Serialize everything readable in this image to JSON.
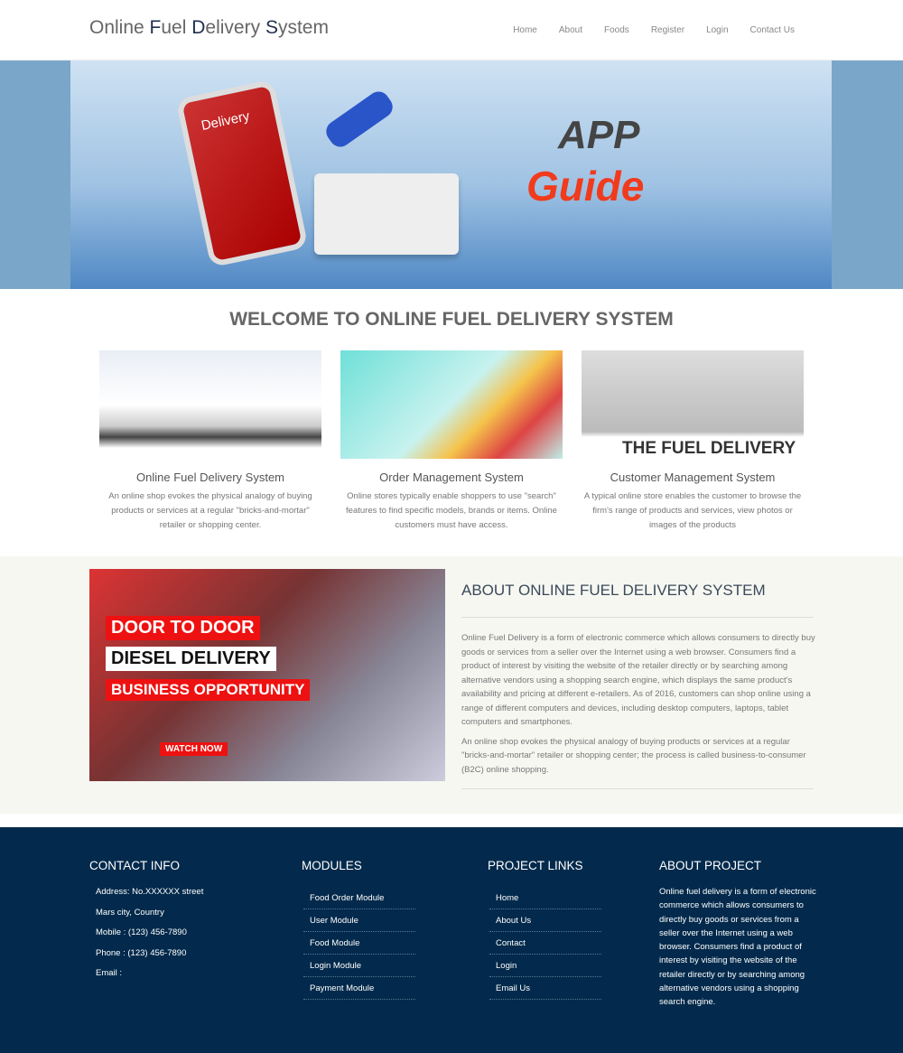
{
  "header": {
    "logo": [
      {
        "t": "Online ",
        "c": false
      },
      {
        "t": "F",
        "c": true
      },
      {
        "t": "uel ",
        "c": false
      },
      {
        "t": "D",
        "c": true
      },
      {
        "t": "elivery ",
        "c": false
      },
      {
        "t": "S",
        "c": true
      },
      {
        "t": "ystem",
        "c": false
      }
    ],
    "nav": [
      "Home",
      "About",
      "Foods",
      "Register",
      "Login",
      "Contact Us"
    ]
  },
  "banner": {
    "phone_text": "Delivery",
    "app": "APP",
    "guide": "Guide"
  },
  "welcome": "WELCOME TO ONLINE FUEL DELIVERY SYSTEM",
  "cards": [
    {
      "title": "Online Fuel Delivery System",
      "text": "An online shop evokes the physical analogy of buying products or services at a regular \"bricks-and-mortar\" retailer or shopping center."
    },
    {
      "title": "Order Management System",
      "text": "Online stores typically enable shoppers to use \"search\" features to find specific models, brands or items. Online customers must have access."
    },
    {
      "title": "Customer Management System",
      "text": "A typical online store enables the customer to browse the firm's range of products and services, view photos or images of the products",
      "img_caption": "THE FUEL DELIVERY"
    }
  ],
  "about": {
    "image_text": [
      "DOOR TO DOOR",
      "DIESEL DELIVERY",
      "BUSINESS OPPORTUNITY",
      "WATCH NOW"
    ],
    "title": "ABOUT ONLINE FUEL DELIVERY SYSTEM",
    "p1": "Online Fuel Delivery is a form of electronic commerce which allows consumers to directly buy goods or services from a seller over the Internet using a web browser. Consumers find a product of interest by visiting the website of the retailer directly or by searching among alternative vendors using a shopping search engine, which displays the same product's availability and pricing at different e-retailers. As of 2016, customers can shop online using a range of different computers and devices, including desktop computers, laptops, tablet computers and smartphones.",
    "p2": "An online shop evokes the physical analogy of buying products or services at a regular \"bricks-and-mortar\" retailer or shopping center; the process is called business-to-consumer (B2C) online shopping."
  },
  "footer": {
    "contact": {
      "title": "CONTACT INFO",
      "lines": [
        "Address: No.XXXXXX street",
        "Mars city, Country",
        "Mobile : (123) 456-7890",
        "Phone : (123) 456-7890",
        "Email :"
      ]
    },
    "modules": {
      "title": "MODULES",
      "items": [
        "Food Order Module",
        "User Module",
        "Food Module",
        "Login Module",
        "Payment Module"
      ]
    },
    "links": {
      "title": "PROJECT LINKS",
      "items": [
        "Home",
        "About Us",
        "Contact",
        "Login",
        "Email Us"
      ]
    },
    "about": {
      "title": "ABOUT PROJECT",
      "text": "Online fuel delivery is a form of electronic commerce which allows consumers to directly buy goods or services from a seller over the Internet using a web browser. Consumers find a product of interest by visiting the website of the retailer directly or by searching among alternative vendors using a shopping search engine."
    }
  }
}
